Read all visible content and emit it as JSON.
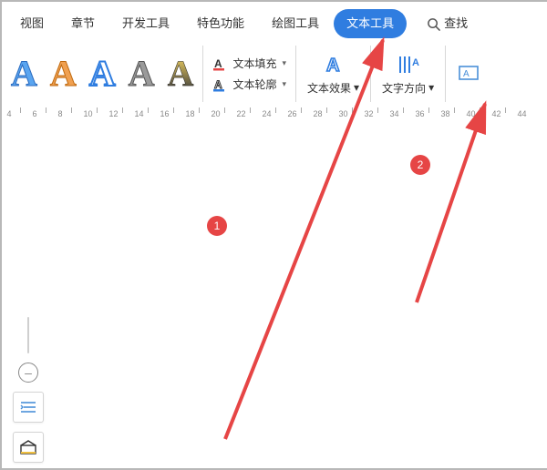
{
  "tabs": {
    "items": [
      {
        "label": "视图"
      },
      {
        "label": "章节"
      },
      {
        "label": "开发工具"
      },
      {
        "label": "特色功能"
      },
      {
        "label": "绘图工具"
      },
      {
        "label": "文本工具"
      },
      {
        "label": "查找"
      }
    ],
    "active_index": 5
  },
  "ribbon": {
    "text_fill_label": "文本填充",
    "text_outline_label": "文本轮廓",
    "text_effects_label": "文本效果",
    "text_direction_label": "文字方向"
  },
  "ruler": {
    "major_labels": [
      4,
      6,
      8,
      10,
      12,
      14,
      16,
      18,
      20,
      22,
      24,
      26,
      28,
      30,
      32,
      34,
      36,
      38,
      40,
      42,
      44
    ]
  },
  "annotations": {
    "badge1": "1",
    "badge2": "2"
  }
}
